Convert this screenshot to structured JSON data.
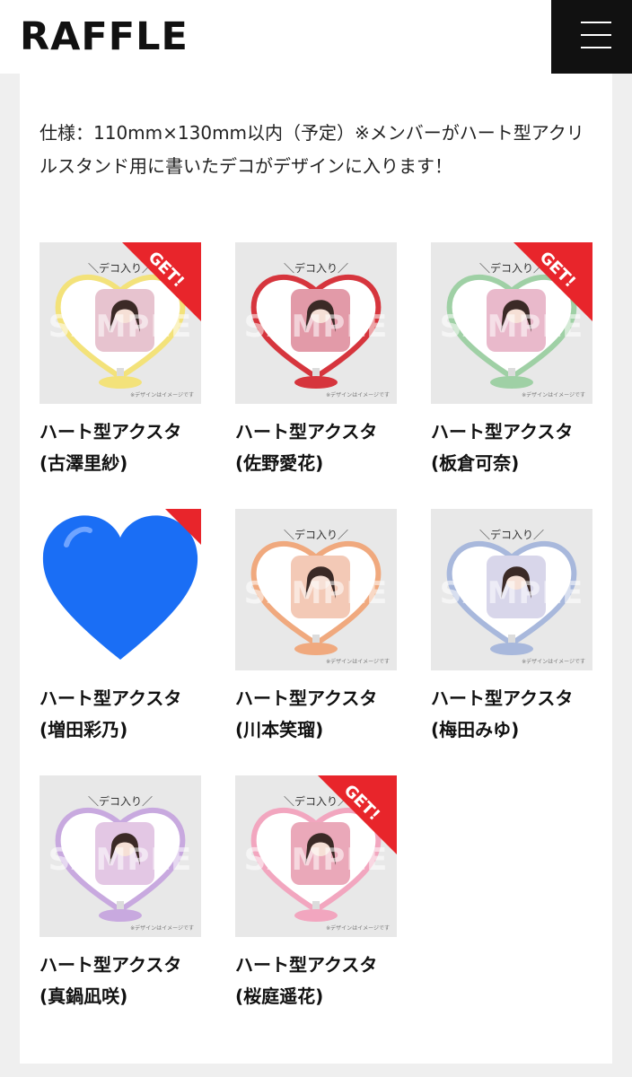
{
  "header": {
    "logo": "RAFFLE",
    "menu_icon": "hamburger-menu-icon"
  },
  "spec_text": "仕様：110mm×130mm以内（予定）※メンバーがハート型アクリルスタンド用に書いたデコがデザインに入ります！",
  "thumb_common": {
    "deco_label": "＼デコ入り／",
    "design_note": "※デザインはイメージです",
    "watermark": "SAMPLE",
    "get_badge": "GET!"
  },
  "items": [
    {
      "title": "ハート型アクスタ",
      "member": "(古澤里紗)",
      "get": true,
      "heart_color": "#f3e27a",
      "photo_color": "#e7c3cf"
    },
    {
      "title": "ハート型アクスタ",
      "member": "(佐野愛花)",
      "get": false,
      "heart_color": "#d6353d",
      "photo_color": "#e29aa8"
    },
    {
      "title": "ハート型アクスタ",
      "member": "(板倉可奈)",
      "get": true,
      "heart_color": "#9fd0a5",
      "photo_color": "#e9b9cb"
    },
    {
      "title": "ハート型アクスタ",
      "member": "(増田彩乃)",
      "get": true,
      "heart_color": "#1a6ef5",
      "photo_color": "",
      "emoji_heart": true
    },
    {
      "title": "ハート型アクスタ",
      "member": "(川本笑瑠)",
      "get": false,
      "heart_color": "#f0a97e",
      "photo_color": "#f3c9b6"
    },
    {
      "title": "ハート型アクスタ",
      "member": "(梅田みゆ)",
      "get": false,
      "heart_color": "#a8b8dc",
      "photo_color": "#d8d6ea"
    },
    {
      "title": "ハート型アクスタ",
      "member": "(真鍋凪咲)",
      "get": false,
      "heart_color": "#c8a9df",
      "photo_color": "#e3c7e4"
    },
    {
      "title": "ハート型アクスタ",
      "member": "(桜庭遥花)",
      "get": true,
      "heart_color": "#f2a6bf",
      "photo_color": "#eaa8b9"
    }
  ]
}
